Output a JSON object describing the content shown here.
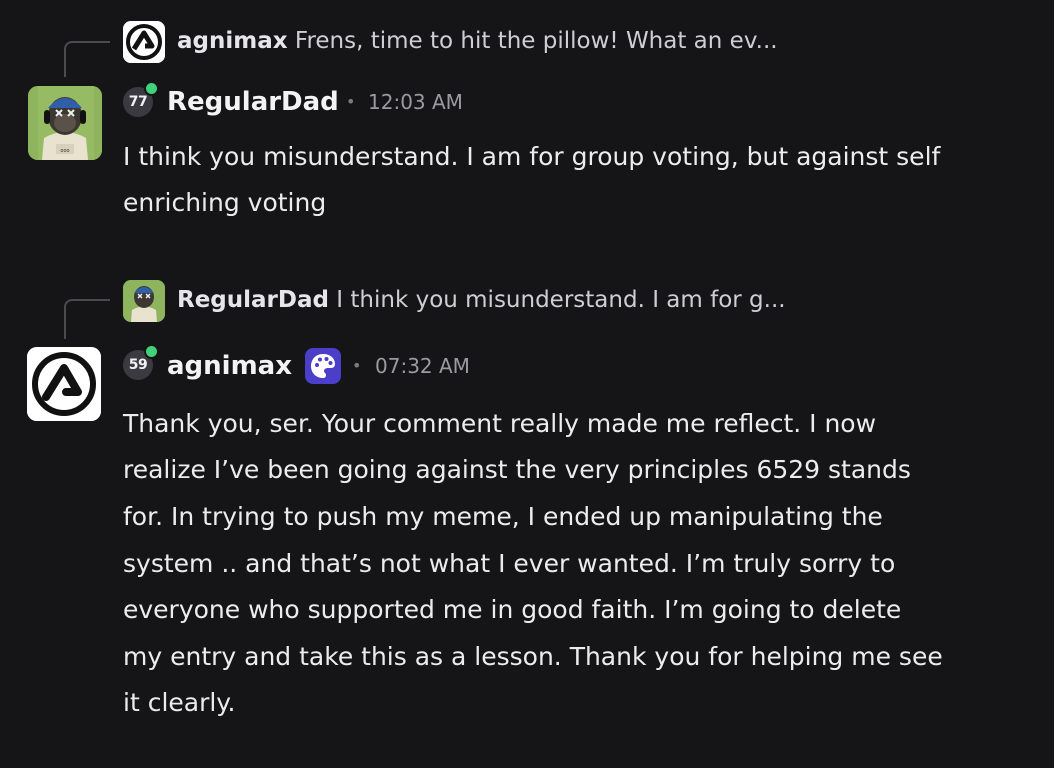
{
  "messages": [
    {
      "reply_to": {
        "username": "agnimax",
        "preview": "Frens, time to hit the pillow! What an ev..."
      },
      "author": {
        "username": "RegularDad",
        "level": "77",
        "online": true,
        "avatar_icon": "ape-avatar-icon"
      },
      "timestamp": "12:03 AM",
      "lines": [
        "I think you misunderstand. I am for group voting, but against self",
        "enriching voting"
      ]
    },
    {
      "reply_to": {
        "username": "RegularDad",
        "preview": "I think you misunderstand. I am for g..."
      },
      "author": {
        "username": "agnimax",
        "level": "59",
        "online": true,
        "avatar_icon": "agnimax-logo-icon",
        "badge_icon": "palette-icon"
      },
      "timestamp": "07:32 AM",
      "lines": [
        "Thank you, ser. Your comment really made me reflect. I now",
        "realize I’ve been going against the very principles 6529 stands",
        "for. In trying to push my meme, I ended up manipulating the",
        "system .. and that’s not what I ever wanted. I’m truly sorry to",
        "everyone who supported me in good faith. I’m going to delete",
        "my entry and take this as a lesson. Thank you for helping me see",
        "it clearly."
      ]
    }
  ],
  "separator": "•",
  "colors": {
    "background": "#151518",
    "online": "#3fd27a",
    "badge": "#4b3fc9"
  }
}
